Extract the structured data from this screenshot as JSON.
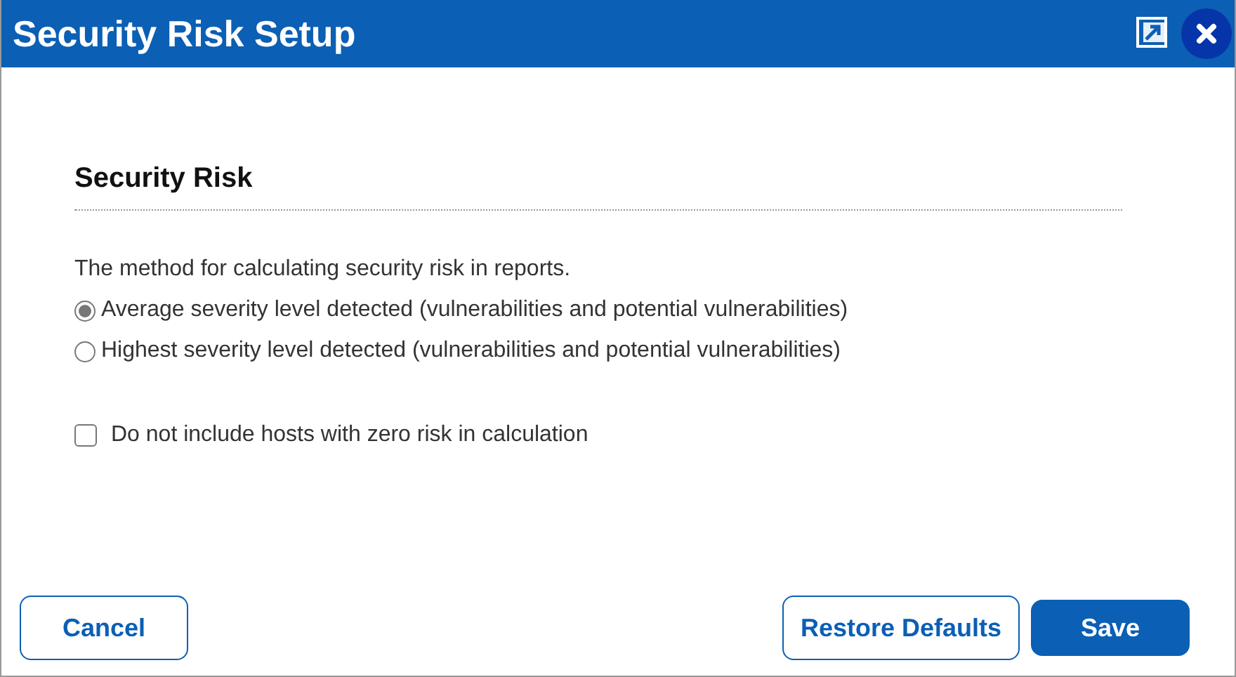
{
  "window": {
    "title": "Security Risk Setup"
  },
  "section": {
    "title": "Security Risk",
    "description": "The method for calculating security risk in reports.",
    "options": [
      {
        "label": "Average severity level detected (vulnerabilities and potential vulnerabilities)",
        "selected": true
      },
      {
        "label": "Highest severity level detected (vulnerabilities and potential vulnerabilities)",
        "selected": false
      }
    ],
    "checkbox": {
      "label": "Do not include hosts with zero risk in calculation",
      "checked": false
    }
  },
  "footer": {
    "left_buttons": [
      {
        "label": "Cancel",
        "kind": "secondary"
      }
    ],
    "right_buttons": [
      {
        "label": "Restore Defaults",
        "kind": "secondary"
      },
      {
        "label": "Save",
        "kind": "primary"
      }
    ]
  }
}
